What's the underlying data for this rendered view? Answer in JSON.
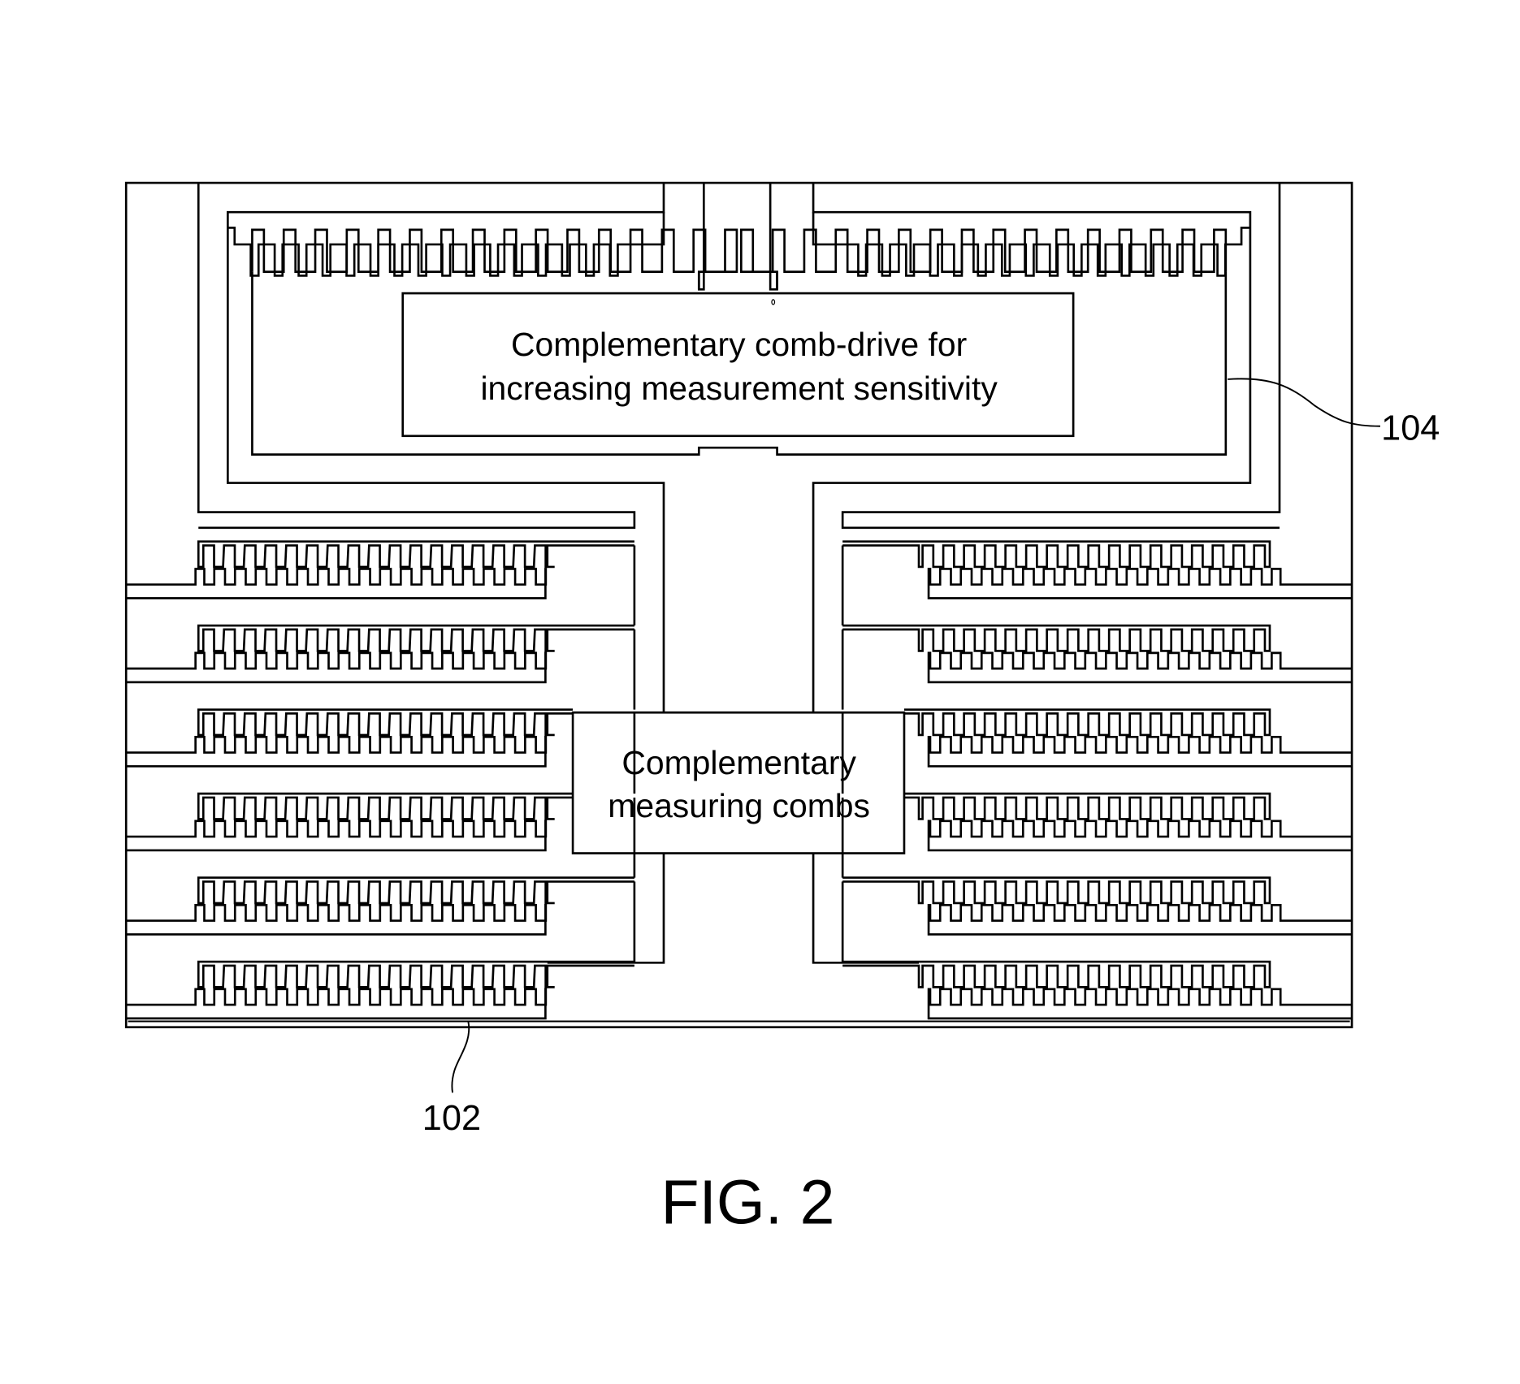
{
  "figure": {
    "caption": "FIG. 2",
    "labels": {
      "drive_box_line1": "Complementary comb-drive for",
      "drive_box_line2": "increasing measurement sensitivity",
      "measure_box_line1": "Complementary",
      "measure_box_line2": "measuring combs"
    },
    "reference_numerals": {
      "measuring_comb": "102",
      "drive_comb": "104"
    },
    "colors": {
      "line": "#000000",
      "background": "#ffffff"
    },
    "structure": {
      "measuring_comb_rows_per_side": 6,
      "drive_comb_sides": 2
    }
  }
}
